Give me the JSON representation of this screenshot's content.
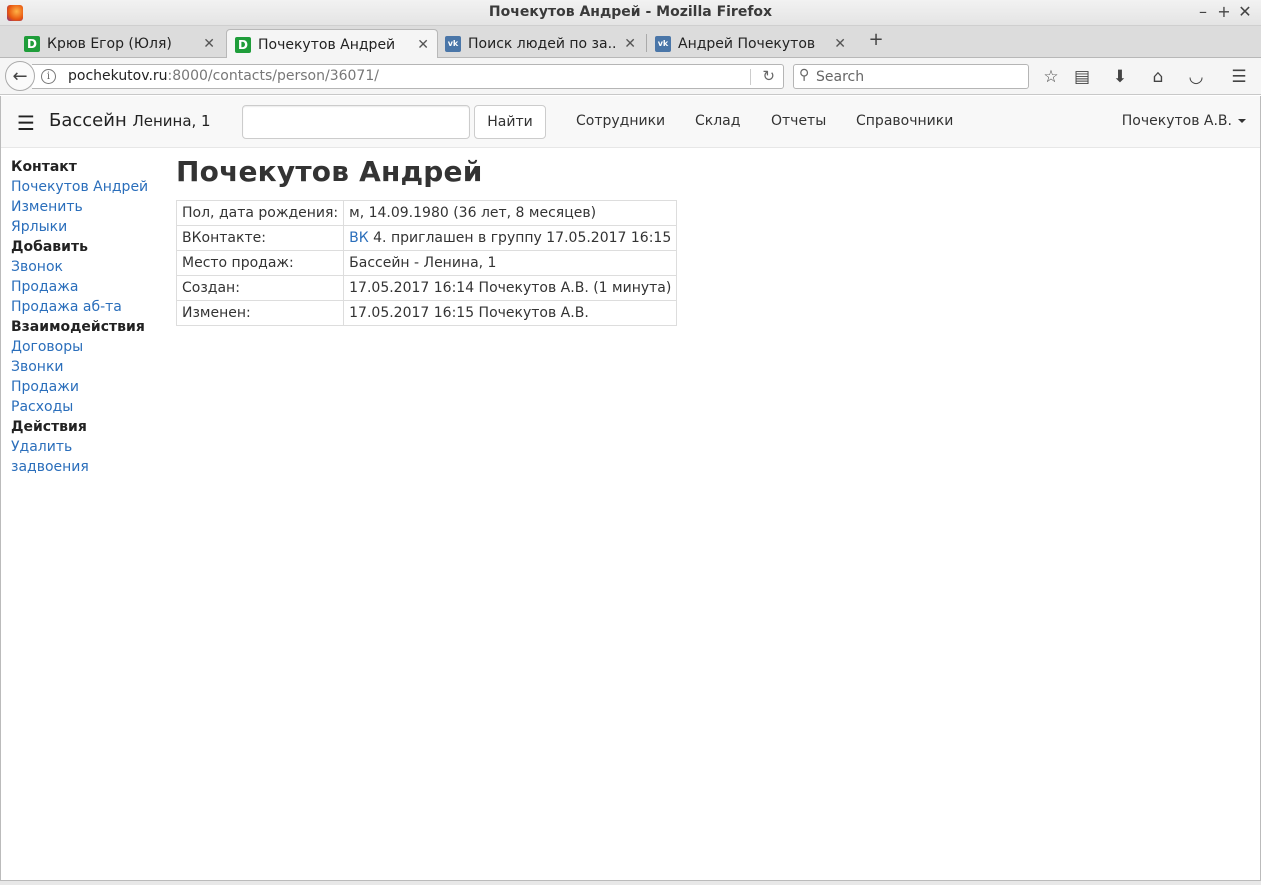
{
  "window": {
    "title": "Почекутов Андрей - Mozilla Firefox",
    "controls": [
      "–",
      "+",
      "✕"
    ]
  },
  "tabs": [
    {
      "label": "Крюв Егор (Юля)",
      "favicon": "D",
      "active": false
    },
    {
      "label": "Почекутов Андрей",
      "favicon": "D",
      "active": true
    },
    {
      "label": "Поиск людей по за...",
      "favicon": "vk",
      "active": false
    },
    {
      "label": "Андрей Почекутов",
      "favicon": "vk",
      "active": false
    }
  ],
  "browser": {
    "url_host": "pochekutov.ru",
    "url_rest": ":8000/contacts/person/36071/",
    "search_placeholder": "Search"
  },
  "site": {
    "brand": "Бассейн",
    "brand_sub": "Ленина, 1",
    "search_value": "",
    "find_button": "Найти",
    "nav": [
      "Сотрудники",
      "Склад",
      "Отчеты",
      "Справочники"
    ],
    "user": "Почекутов А.В."
  },
  "sidebar": {
    "sections": [
      {
        "heading": "Контакт",
        "links": [
          "Почекутов Андрей",
          "Изменить",
          "Ярлыки"
        ]
      },
      {
        "heading": "Добавить",
        "links": [
          "Звонок",
          "Продажа",
          "Продажа аб-та"
        ]
      },
      {
        "heading": "Взаимодействия",
        "links": [
          "Договоры",
          "Звонки",
          "Продажи",
          "Расходы"
        ]
      },
      {
        "heading": "Действия",
        "links": [
          "Удалить",
          "задвоения"
        ]
      }
    ]
  },
  "page": {
    "title": "Почекутов Андрей",
    "rows": [
      {
        "label": "Пол, дата рождения:",
        "value": "м, 14.09.1980 (36 лет, 8 месяцев)"
      },
      {
        "label": "ВКонтакте:",
        "link": "ВК",
        "value": "4. приглашен в группу 17.05.2017 16:15"
      },
      {
        "label": "Место продаж:",
        "value": "Бассейн - Ленина, 1"
      },
      {
        "label": "Создан:",
        "value": "17.05.2017 16:14 Почекутов А.В. (1 минута)"
      },
      {
        "label": "Изменен:",
        "value": "17.05.2017 16:15 Почекутов А.В."
      }
    ]
  }
}
